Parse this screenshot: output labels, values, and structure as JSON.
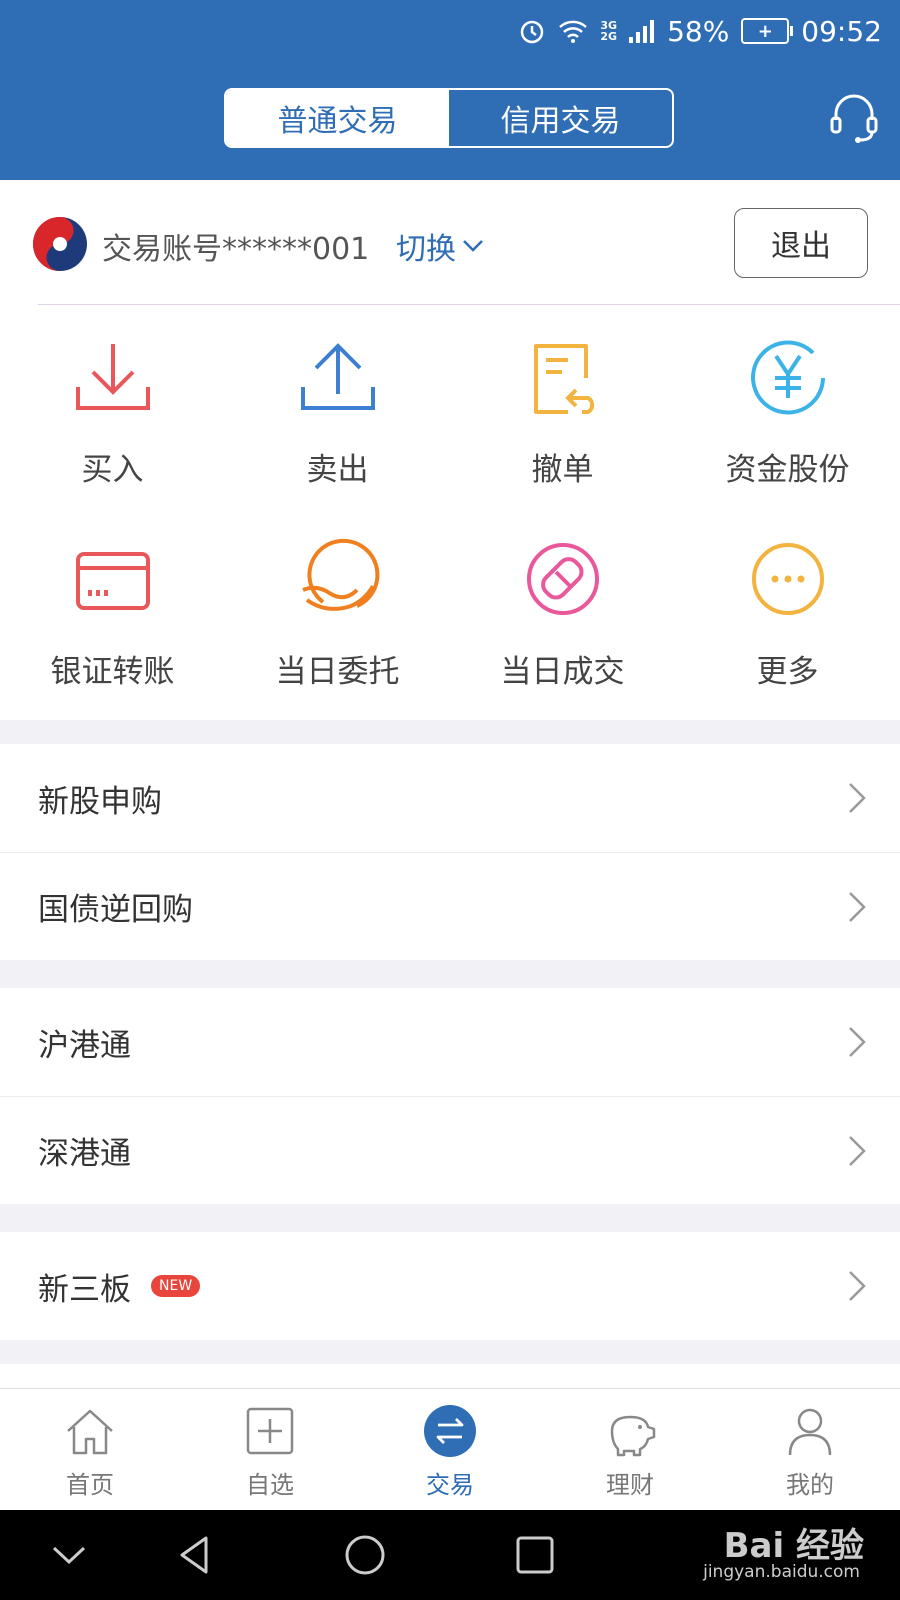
{
  "status_bar": {
    "network": [
      "3G",
      "2G"
    ],
    "battery": "58%",
    "time": "09:52"
  },
  "header": {
    "tabs": [
      {
        "label": "普通交易",
        "active": true
      },
      {
        "label": "信用交易",
        "active": false
      }
    ],
    "customer_service_icon": "headset-icon"
  },
  "account": {
    "label": "交易账号******001",
    "switch_label": "切换",
    "logout_label": "退出"
  },
  "functions": [
    {
      "label": "买入",
      "icon": "download-icon",
      "color": "#e8585b"
    },
    {
      "label": "卖出",
      "icon": "upload-icon",
      "color": "#3d7fd0"
    },
    {
      "label": "撤单",
      "icon": "revoke-icon",
      "color": "#f2b33f"
    },
    {
      "label": "资金股份",
      "icon": "yuan-icon",
      "color": "#3cb3e8"
    },
    {
      "label": "银证转账",
      "icon": "card-icon",
      "color": "#e8585b"
    },
    {
      "label": "当日委托",
      "icon": "hand-icon",
      "color": "#f0801f"
    },
    {
      "label": "当日成交",
      "icon": "deal-icon",
      "color": "#e8589a"
    },
    {
      "label": "更多",
      "icon": "more-icon",
      "color": "#f2b33f"
    }
  ],
  "list_groups": [
    [
      {
        "label": "新股申购"
      },
      {
        "label": "国债逆回购"
      }
    ],
    [
      {
        "label": "沪港通"
      },
      {
        "label": "深港通"
      }
    ],
    [
      {
        "label": "新三板",
        "badge": "NEW"
      }
    ]
  ],
  "tab_bar": [
    {
      "label": "首页",
      "icon": "home-icon",
      "active": false
    },
    {
      "label": "自选",
      "icon": "add-square-icon",
      "active": false
    },
    {
      "label": "交易",
      "icon": "exchange-icon",
      "active": true
    },
    {
      "label": "理财",
      "icon": "piggy-bank-icon",
      "active": false
    },
    {
      "label": "我的",
      "icon": "user-icon",
      "active": false
    }
  ],
  "watermark": {
    "brand": "Bai 经验",
    "url": "jingyan.baidu.com"
  }
}
